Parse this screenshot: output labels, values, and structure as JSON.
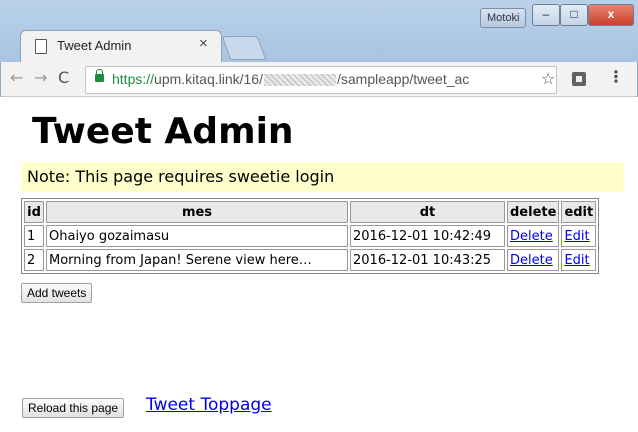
{
  "window": {
    "tab_title": "Tweet Admin",
    "tab_close": "×",
    "profile": "Motoki",
    "min": "–",
    "max": "□",
    "close": "x"
  },
  "toolbar": {
    "back": "←",
    "forward": "→",
    "reload": "C",
    "url_scheme": "https://",
    "url_host": "upm.kitaq.link/16/",
    "url_path": "/sampleapp/tweet_ac",
    "star": "☆",
    "menu": "⋮"
  },
  "page": {
    "title": "Tweet Admin",
    "note": "Note: This page requires sweetie login",
    "table": {
      "headers": [
        "id",
        "mes",
        "dt",
        "delete",
        "edit"
      ],
      "rows": [
        {
          "id": "1",
          "mes": "Ohaiyo gozaimasu",
          "dt": "2016-12-01 10:42:49",
          "delete": "Delete",
          "edit": "Edit"
        },
        {
          "id": "2",
          "mes": "Morning from Japan! Serene view here…",
          "dt": "2016-12-01 10:43:25",
          "delete": "Delete",
          "edit": "Edit"
        }
      ]
    },
    "add_button": "Add tweets",
    "reload_button": "Reload this page",
    "toppage_link": "Tweet Toppage"
  }
}
